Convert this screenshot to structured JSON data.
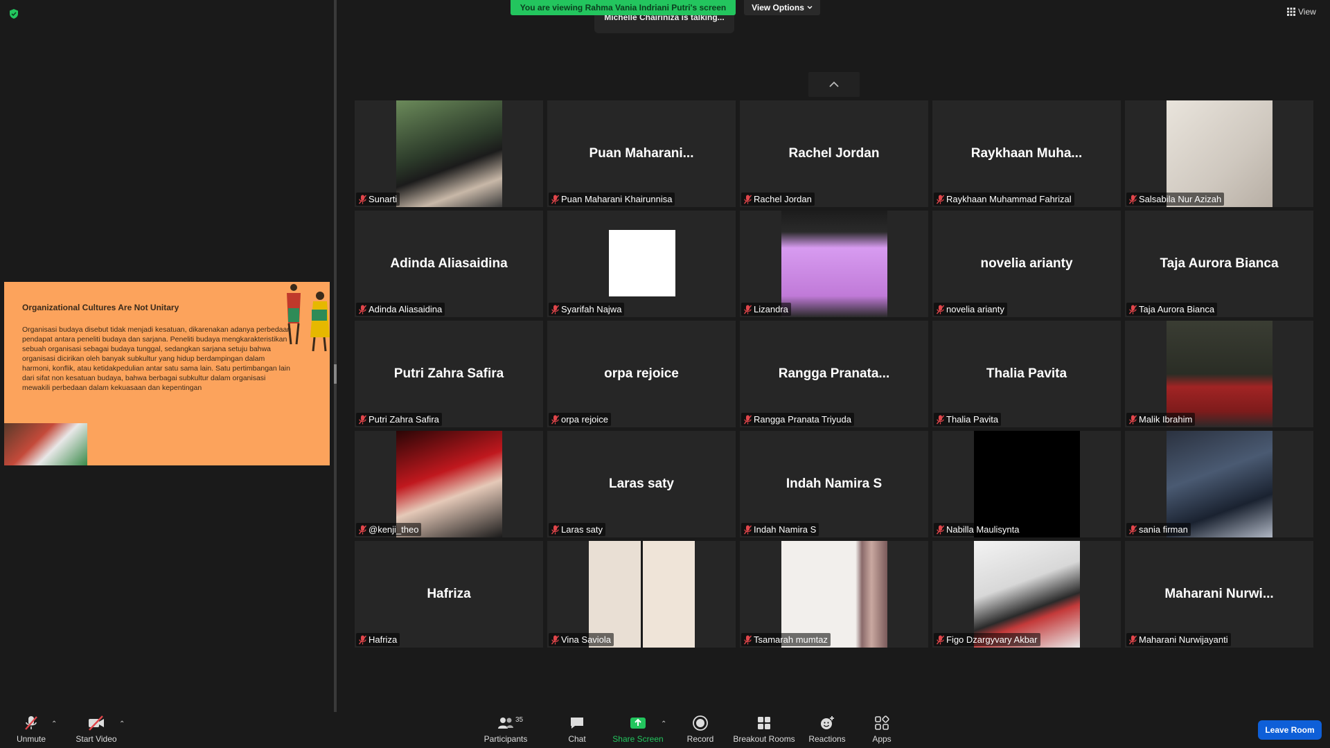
{
  "banner": {
    "sharing_text": "You are viewing Rahma Vania Indriani Putri's screen",
    "view_options": "View Options",
    "talking": "Michelle Chairiniza is talking...",
    "view": "View"
  },
  "slide": {
    "title": "Organizational Cultures Are Not Unitary",
    "body": " Organisasi budaya disebut tidak menjadi kesatuan, dikarenakan adanya perbedaan pendapat antara peneliti budaya dan sarjana. Peneliti budaya mengkarakteristikan sebuah organisasi sebagai budaya tunggal, sedangkan sarjana setuju bahwa organisasi dicirikan oleh banyak subkultur yang hidup berdampingan dalam harmoni, konflik, atau ketidakpedulian antar satu sama lain. Satu pertimbangan lain dari sifat non kesatuan budaya, bahwa berbagai subkultur dalam organisasi mewakili perbedaan dalam kekuasaan dan kepentingan"
  },
  "participants": [
    {
      "label": "Sunarti",
      "big": "",
      "video": "photo-hijab"
    },
    {
      "label": "Puan Maharani Khairunnisa",
      "big": "Puan  Maharani...",
      "video": ""
    },
    {
      "label": "Rachel Jordan",
      "big": "Rachel Jordan",
      "video": ""
    },
    {
      "label": "Raykhaan Muhammad Fahrizal",
      "big": "Raykhaan  Muha...",
      "video": ""
    },
    {
      "label": "Salsabila Nur Azizah",
      "big": "",
      "video": "photo-polaroid"
    },
    {
      "label": "Adinda Aliasaidina",
      "big": "Adinda Aliasaidina",
      "video": ""
    },
    {
      "label": "Syarifah Najwa",
      "big": "",
      "video": "photo-portrait"
    },
    {
      "label": "Lizandra",
      "big": "",
      "video": "photo-dress"
    },
    {
      "label": "novelia arianty",
      "big": "novelia arianty",
      "video": ""
    },
    {
      "label": "Taja Aurora Bianca",
      "big": "Taja Aurora Bianca",
      "video": ""
    },
    {
      "label": "Putri Zahra Safira",
      "big": "Putri Zahra Safira",
      "video": ""
    },
    {
      "label": "orpa rejoice",
      "big": "orpa rejoice",
      "video": ""
    },
    {
      "label": "Rangga Pranata Triyuda",
      "big": "Rangga  Pranata...",
      "video": ""
    },
    {
      "label": "Thalia Pavita",
      "big": "Thalia Pavita",
      "video": ""
    },
    {
      "label": "Malik Ibrahim",
      "big": "",
      "video": "photo-red-hoodie"
    },
    {
      "label": "@kenji_theo",
      "big": "",
      "video": "photo-red-light"
    },
    {
      "label": "Laras saty",
      "big": "Laras saty",
      "video": ""
    },
    {
      "label": "Indah Namira S",
      "big": "Indah Namira S",
      "video": ""
    },
    {
      "label": "Nabilla Maulisynta",
      "big": "",
      "video": "photo-black"
    },
    {
      "label": "sania firman",
      "big": "",
      "video": "photo-hero"
    },
    {
      "label": "Hafriza",
      "big": "Hafriza",
      "video": ""
    },
    {
      "label": "Vina Saviola",
      "big": "",
      "video": "photo-collage"
    },
    {
      "label": "Tsamarah mumtaz",
      "big": "",
      "video": "photo-curtain"
    },
    {
      "label": "Figo Dzargyvary Akbar",
      "big": "",
      "video": "photo-office"
    },
    {
      "label": "Maharani Nurwijayanti",
      "big": "Maharani  Nurwi...",
      "video": ""
    }
  ],
  "toolbar": {
    "unmute": "Unmute",
    "start_video": "Start Video",
    "participants": "Participants",
    "participants_count": "35",
    "chat": "Chat",
    "share_screen": "Share Screen",
    "record": "Record",
    "breakout": "Breakout Rooms",
    "reactions": "Reactions",
    "apps": "Apps",
    "leave": "Leave Room"
  },
  "colors": {
    "banner_green": "#23c55e",
    "leave_blue": "#0e5fd8",
    "slide_orange": "#fca35c",
    "mute_red": "#e0454a"
  }
}
